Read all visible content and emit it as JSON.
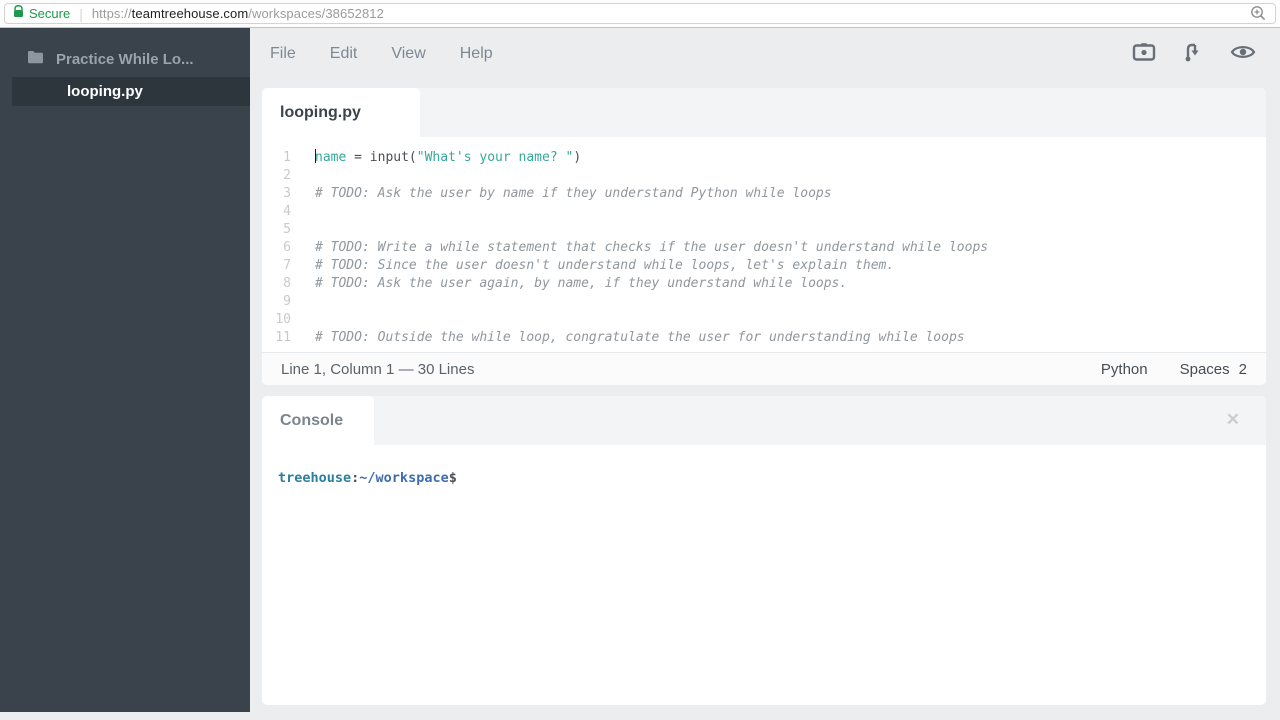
{
  "colors": {
    "secure_green": "#1d9a4e",
    "sidebar_bg": "#3a434b",
    "sidebar_selected_bg": "#2e363d",
    "code_teal": "#35a99b",
    "comment_gray": "#90979d",
    "prompt_host_teal": "#2b7e9d",
    "prompt_path_blue": "#3d6cb1"
  },
  "browser": {
    "security_label": "Secure",
    "url_scheme": "https://",
    "url_domain": "teamtreehouse.com",
    "url_path": "/workspaces/38652812"
  },
  "sidebar": {
    "project_name": "Practice While Lo...",
    "selected_file": "looping.py"
  },
  "menu": {
    "items": [
      "File",
      "Edit",
      "View",
      "Help"
    ]
  },
  "toolbar": {
    "icons": [
      "camera-icon",
      "fork-icon",
      "eye-icon"
    ]
  },
  "editor": {
    "tab_label": "looping.py",
    "lines": [
      {
        "num": "1",
        "cursor": true,
        "tokens": [
          {
            "t": "name",
            "c": "name"
          },
          {
            "t": " = input(",
            "c": "plain"
          },
          {
            "t": "\"What's your name? \"",
            "c": "string"
          },
          {
            "t": ")",
            "c": "plain"
          }
        ]
      },
      {
        "num": "2",
        "tokens": []
      },
      {
        "num": "3",
        "tokens": [
          {
            "t": "# TODO: Ask the user by name if they understand Python while loops",
            "c": "comment"
          }
        ]
      },
      {
        "num": "4",
        "tokens": []
      },
      {
        "num": "5",
        "tokens": []
      },
      {
        "num": "6",
        "tokens": [
          {
            "t": "# TODO: Write a while statement that checks if the user doesn't understand while loops",
            "c": "comment"
          }
        ]
      },
      {
        "num": "7",
        "tokens": [
          {
            "t": "# TODO: Since the user doesn't understand while loops, let's explain them.",
            "c": "comment"
          }
        ]
      },
      {
        "num": "8",
        "tokens": [
          {
            "t": "# TODO: Ask the user again, by name, if they understand while loops.",
            "c": "comment"
          }
        ]
      },
      {
        "num": "9",
        "tokens": []
      },
      {
        "num": "10",
        "tokens": []
      },
      {
        "num": "11",
        "tokens": [
          {
            "t": "# TODO: Outside the while loop, congratulate the user for understanding while loops",
            "c": "comment"
          }
        ]
      }
    ],
    "status": {
      "left": "Line 1, Column 1 — 30 Lines",
      "language": "Python",
      "indent_label": "Spaces",
      "indent_value": "2"
    }
  },
  "console": {
    "tab_label": "Console",
    "close_glyph": "✕",
    "prompt": [
      {
        "t": "treehouse",
        "c": "host"
      },
      {
        "t": ":",
        "c": "plain"
      },
      {
        "t": "~/workspace",
        "c": "path"
      },
      {
        "t": "$",
        "c": "plain"
      }
    ]
  }
}
